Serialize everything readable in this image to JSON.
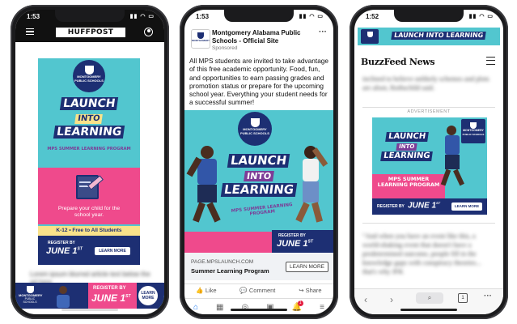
{
  "phone1": {
    "time": "1:53",
    "brand": "HUFFPOST",
    "ad": {
      "logo_line1": "MONTGOMERY",
      "logo_line2": "PUBLIC SCHOOLS",
      "headline_1": "LAUNCH",
      "headline_2": "INTO",
      "headline_3": "LEARNING",
      "program": "MPS SUMMER LEARNING PROGRAM",
      "prepare": "Prepare your child for the school year.",
      "k12": "K-12 • Free to All Students",
      "register_by": "REGISTER BY",
      "date": "JUNE 1",
      "date_sup": "ST",
      "learn_more": "LEARN MORE"
    },
    "blurred_text": "Lorem ipsum blurred article text below the ad here",
    "banner": {
      "logo_line1": "MONTGOMERY",
      "logo_line2": "PUBLIC SCHOOLS",
      "register_by": "REGISTER BY",
      "date": "JUNE 1",
      "date_sup": "ST",
      "learn": "LEARN",
      "more": "MORE"
    }
  },
  "phone2": {
    "time": "1:53",
    "page_name": "Montgomery Alabama Public Schools - Official Site",
    "sponsored": "Sponsored",
    "post_text": "All MPS students are invited to take advantage of this free academic opportunity. Food, fun, and opportunities to earn passing grades and promotion status or prepare for the upcoming school year. Everything your student needs for a successful summer!",
    "ad": {
      "logo_line1": "MONTGOMERY",
      "logo_line2": "PUBLIC SCHOOLS",
      "headline_1": "LAUNCH",
      "headline_2": "INTO",
      "headline_3": "LEARNING",
      "program": "MPS SUMMER LEARNING PROGRAM",
      "register_by": "REGISTER BY",
      "date": "JUNE 1",
      "date_sup": "ST"
    },
    "link_url": "PAGE.MPSLAUNCH.COM",
    "link_title": "Summer Learning Program",
    "learn_more": "LEARN MORE",
    "like": "Like",
    "comment": "Comment",
    "share": "Share",
    "notif_count": "1"
  },
  "phone3": {
    "time": "1:52",
    "brand": "BuzzFeed News",
    "advertisement": "ADVERTISEMENT",
    "blur_top": "inclined to believe unlikely schemes and plots are afoot, Rothschild said.",
    "blur_bottom": "\"And when you have an event like this, a world-shaking event that doesn't have a predetermined outcome, people fill in the knowledge gaps with conspiracy theories... that's why JFK",
    "top_banner": {
      "headline": "LAUNCH INTO LEARNING"
    },
    "ad": {
      "logo_line1": "MONTGOMERY",
      "logo_line2": "PUBLIC SCHOOLS",
      "headline_1": "LAUNCH",
      "headline_2": "INTO",
      "headline_3": "LEARNING",
      "program_1": "MPS SUMMER",
      "program_2": "LEARNING PROGRAM",
      "register_by": "REGISTER BY",
      "date": "JUNE 1",
      "date_sup": "ST",
      "learn_more": "LEARN MORE"
    },
    "tab_count": "1"
  }
}
